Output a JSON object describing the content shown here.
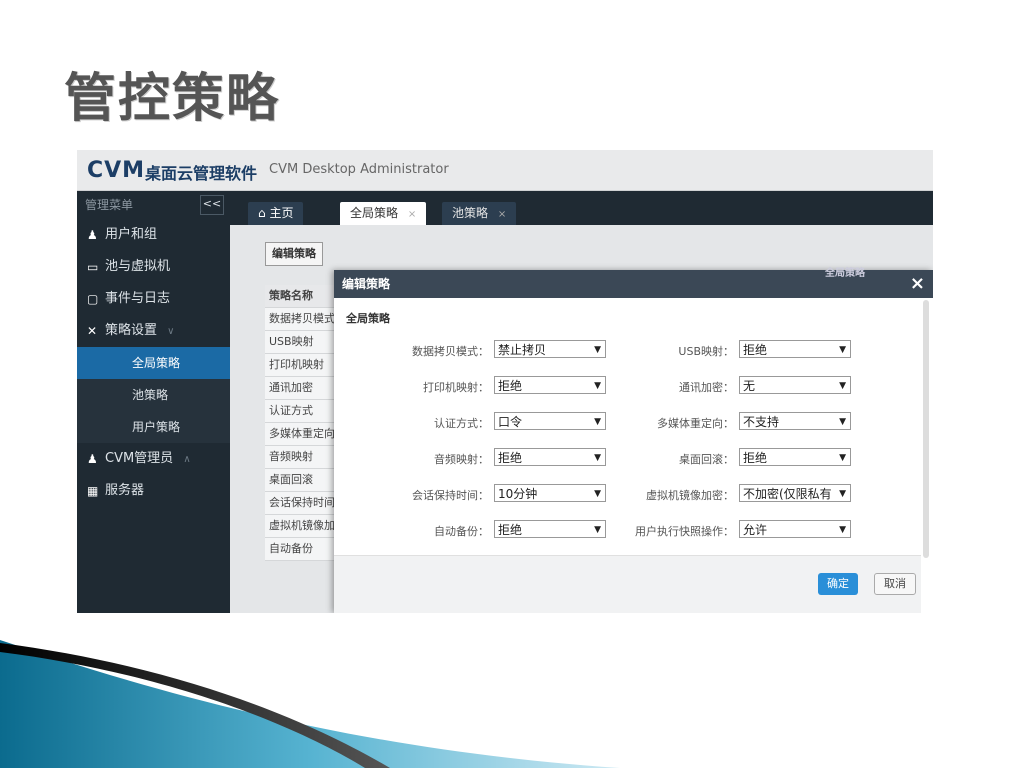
{
  "slide": {
    "title": "管控策略"
  },
  "app": {
    "logo": "CVM",
    "name": "桌面云管理软件",
    "subtitle": "CVM Desktop Administrator"
  },
  "sidebar": {
    "header": "管理菜单",
    "toggle": "<<",
    "items": [
      {
        "label": "用户和组",
        "icon": "users-icon"
      },
      {
        "label": "池与虚拟机",
        "icon": "monitor-icon"
      },
      {
        "label": "事件与日志",
        "icon": "document-icon"
      },
      {
        "label": "策略设置",
        "icon": "tools-icon",
        "caret": "∨"
      }
    ],
    "subitems": [
      {
        "label": "全局策略",
        "active": true
      },
      {
        "label": "池策略"
      },
      {
        "label": "用户策略"
      }
    ],
    "more": [
      {
        "label": "CVM管理员",
        "icon": "admin-icon",
        "caret": "∧"
      },
      {
        "label": "服务器",
        "icon": "server-icon"
      }
    ]
  },
  "tabs": [
    {
      "label": "主页",
      "icon": "home-icon"
    },
    {
      "label": "全局策略",
      "close": "×"
    },
    {
      "label": "池策略",
      "close": "×"
    }
  ],
  "content": {
    "edit_button": "编辑策略",
    "table_header": "策略名称",
    "rows": [
      "数据拷贝模式",
      "USB映射",
      "打印机映射",
      "通讯加密",
      "认证方式",
      "多媒体重定向",
      "音频映射",
      "桌面回滚",
      "会话保持时间",
      "虚拟机镜像加",
      "自动备份"
    ]
  },
  "dialog": {
    "title": "编辑策略",
    "ghost": "全局策略",
    "close": "×",
    "section": "全局策略",
    "fields_left": [
      {
        "label": "数据拷贝模式：",
        "value": "禁止拷贝"
      },
      {
        "label": "打印机映射：",
        "value": "拒绝"
      },
      {
        "label": "认证方式：",
        "value": "口令"
      },
      {
        "label": "音频映射：",
        "value": "拒绝"
      },
      {
        "label": "会话保持时间：",
        "value": "10分钟"
      },
      {
        "label": "自动备份：",
        "value": "拒绝"
      }
    ],
    "fields_right": [
      {
        "label": "USB映射：",
        "value": "拒绝"
      },
      {
        "label": "通讯加密：",
        "value": "无"
      },
      {
        "label": "多媒体重定向：",
        "value": "不支持"
      },
      {
        "label": "桌面回滚：",
        "value": "拒绝"
      },
      {
        "label": "虚拟机镜像加密：",
        "value": "不加密(仅限私有"
      },
      {
        "label": "用户执行快照操作：",
        "value": "允许"
      }
    ],
    "arrow": "▼",
    "ok": "确定",
    "cancel": "取消"
  },
  "colors": {
    "accent": "#1b6aa5",
    "sidebar": "#1f2a33",
    "ok": "#2a8fd8"
  }
}
